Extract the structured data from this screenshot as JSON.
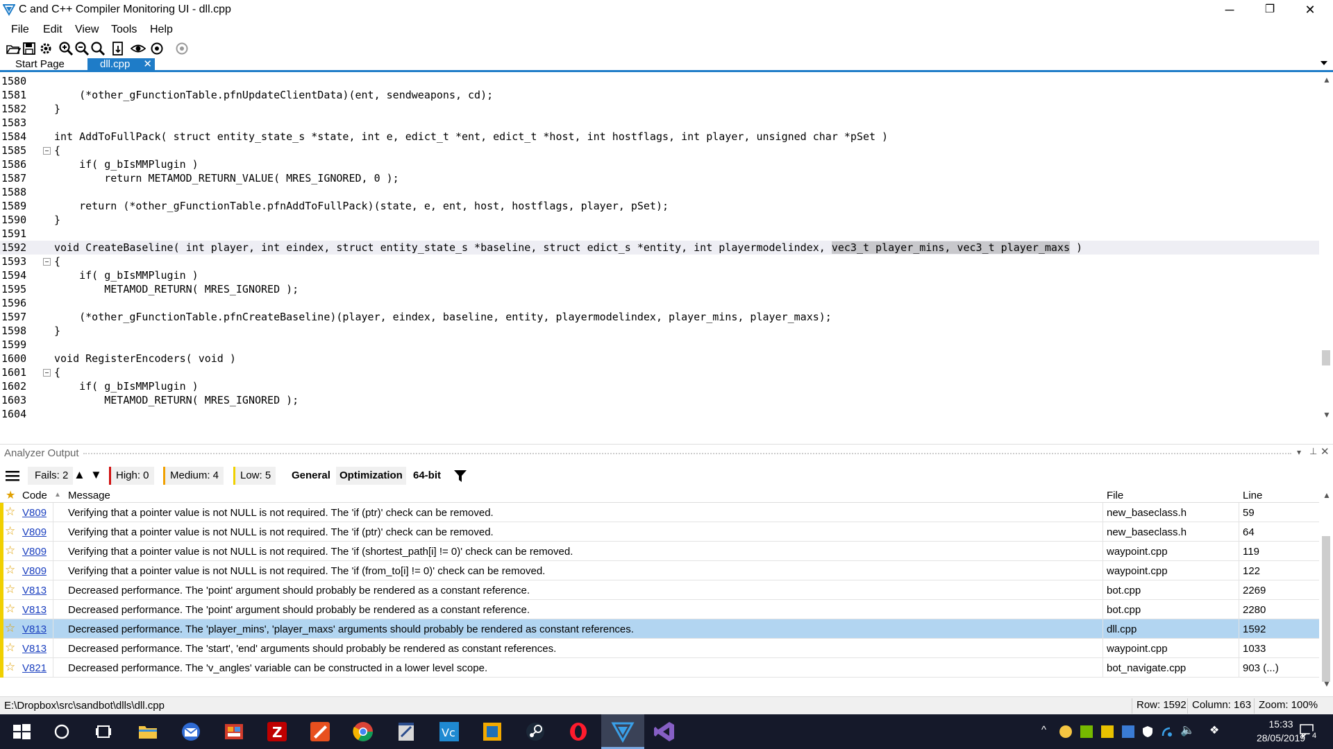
{
  "window": {
    "title": "C and C++ Compiler Monitoring UI - dll.cpp",
    "minimize": "─",
    "restore": "❐",
    "close": "✕"
  },
  "menu": [
    "File",
    "Edit",
    "View",
    "Tools",
    "Help"
  ],
  "toolbar_icons": [
    "open-icon",
    "save-icon",
    "settings-icon",
    "zoom-in-icon",
    "zoom-out-icon",
    "zoom-reset-icon",
    "export-icon",
    "eye-icon",
    "navigate-icon",
    "navigate-disabled-icon"
  ],
  "tabs": {
    "start": "Start Page",
    "active": "dll.cpp",
    "close": "✕"
  },
  "editor": {
    "lines": [
      {
        "n": "1580",
        "code": ""
      },
      {
        "n": "1581",
        "code": "    (*other_gFunctionTable.pfnUpdateClientData)(ent, sendweapons, cd);"
      },
      {
        "n": "1582",
        "code": "}"
      },
      {
        "n": "1583",
        "code": ""
      },
      {
        "n": "1584",
        "code": "int AddToFullPack( struct entity_state_s *state, int e, edict_t *ent, edict_t *host, int hostflags, int player, unsigned char *pSet )"
      },
      {
        "n": "1585",
        "code": "{",
        "fold": true
      },
      {
        "n": "1586",
        "code": "    if( g_bIsMMPlugin )"
      },
      {
        "n": "1587",
        "code": "        return METAMOD_RETURN_VALUE( MRES_IGNORED, 0 );"
      },
      {
        "n": "1588",
        "code": ""
      },
      {
        "n": "1589",
        "code": "    return (*other_gFunctionTable.pfnAddToFullPack)(state, e, ent, host, hostflags, player, pSet);"
      },
      {
        "n": "1590",
        "code": "}"
      },
      {
        "n": "1591",
        "code": ""
      },
      {
        "n": "1592",
        "code": "void CreateBaseline( int player, int eindex, struct entity_state_s *baseline, struct edict_s *entity, int playermodelindex, vec3_t player_mins, vec3_t player_maxs )",
        "current": true
      },
      {
        "n": "1593",
        "code": "{",
        "fold": true
      },
      {
        "n": "1594",
        "code": "    if( g_bIsMMPlugin )"
      },
      {
        "n": "1595",
        "code": "        METAMOD_RETURN( MRES_IGNORED );"
      },
      {
        "n": "1596",
        "code": ""
      },
      {
        "n": "1597",
        "code": "    (*other_gFunctionTable.pfnCreateBaseline)(player, eindex, baseline, entity, playermodelindex, player_mins, player_maxs);"
      },
      {
        "n": "1598",
        "code": "}"
      },
      {
        "n": "1599",
        "code": ""
      },
      {
        "n": "1600",
        "code": "void RegisterEncoders( void )"
      },
      {
        "n": "1601",
        "code": "{",
        "fold": true
      },
      {
        "n": "1602",
        "code": "    if( g_bIsMMPlugin )"
      },
      {
        "n": "1603",
        "code": "        METAMOD_RETURN( MRES_IGNORED );"
      },
      {
        "n": "1604",
        "code": ""
      }
    ]
  },
  "analyzer": {
    "title": "Analyzer Output",
    "fails": "Fails: 2",
    "high": "High: 0",
    "medium": "Medium: 4",
    "low": "Low: 5",
    "general": "General",
    "optimization": "Optimization",
    "bit64": "64-bit",
    "colors": {
      "high": "#d01010",
      "medium": "#f0a000",
      "low": "#f0d000"
    },
    "headers": {
      "code": "Code",
      "message": "Message",
      "file": "File",
      "line": "Line"
    },
    "rows": [
      {
        "code": "V809",
        "message": "Verifying that a pointer value is not NULL is not required. The 'if (ptr)' check can be removed.",
        "file": "new_baseclass.h",
        "line": "59"
      },
      {
        "code": "V809",
        "message": "Verifying that a pointer value is not NULL is not required. The 'if (ptr)' check can be removed.",
        "file": "new_baseclass.h",
        "line": "64"
      },
      {
        "code": "V809",
        "message": "Verifying that a pointer value is not NULL is not required. The 'if (shortest_path[i] != 0)' check can be removed.",
        "file": "waypoint.cpp",
        "line": "119"
      },
      {
        "code": "V809",
        "message": "Verifying that a pointer value is not NULL is not required. The 'if (from_to[i] != 0)' check can be removed.",
        "file": "waypoint.cpp",
        "line": "122"
      },
      {
        "code": "V813",
        "message": "Decreased performance. The 'point' argument should probably be rendered as a constant reference.",
        "file": "bot.cpp",
        "line": "2269"
      },
      {
        "code": "V813",
        "message": "Decreased performance. The 'point' argument should probably be rendered as a constant reference.",
        "file": "bot.cpp",
        "line": "2280"
      },
      {
        "code": "V813",
        "message": "Decreased performance. The 'player_mins', 'player_maxs' arguments should probably be rendered as constant references.",
        "file": "dll.cpp",
        "line": "1592",
        "selected": true
      },
      {
        "code": "V813",
        "message": "Decreased performance. The 'start', 'end' arguments should probably be rendered as constant references.",
        "file": "waypoint.cpp",
        "line": "1033"
      },
      {
        "code": "V821",
        "message": "Decreased performance. The 'v_angles' variable can be constructed in a lower level scope.",
        "file": "bot_navigate.cpp",
        "line": "903 (...)"
      }
    ]
  },
  "status": {
    "path": "E:\\Dropbox\\src\\sandbot\\dlls\\dll.cpp",
    "row": "Row: 1592",
    "column": "Column: 163",
    "zoom": "Zoom: 100%"
  },
  "taskbar": {
    "apps": [
      "windows-start-icon",
      "cortana-icon",
      "task-view-icon",
      "file-explorer-icon",
      "thunderbird-icon",
      "app-icon",
      "filezilla-icon",
      "paint-icon",
      "chrome-icon",
      "app-icon",
      "vs-code-icon",
      "app-icon",
      "steam-icon",
      "opera-icon",
      "pvs-studio-icon",
      "visual-studio-icon"
    ],
    "time": "15:33",
    "date": "28/05/2019",
    "notifications": "4"
  }
}
